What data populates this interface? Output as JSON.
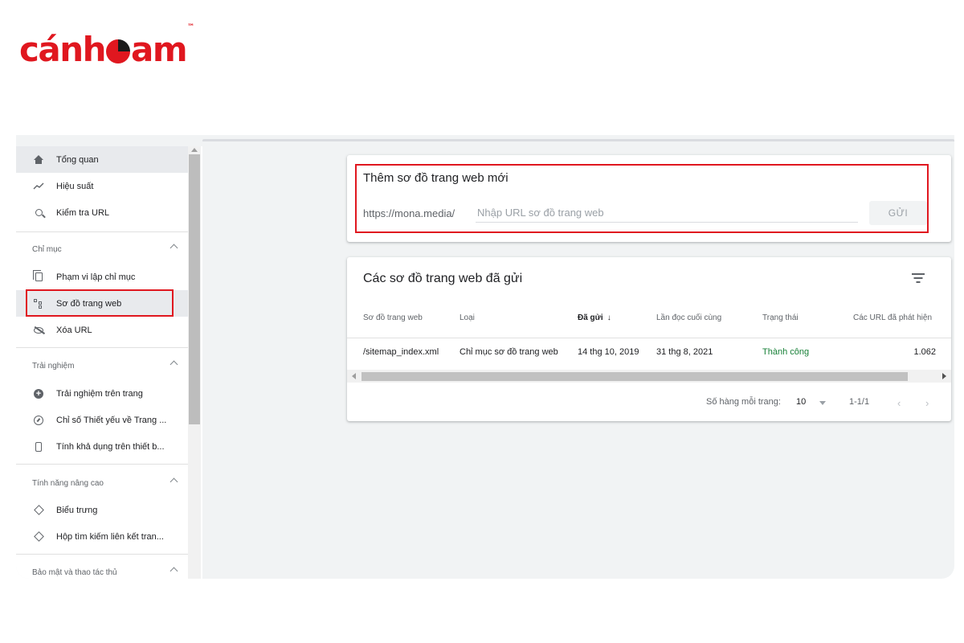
{
  "logo": {
    "part1": "cánh",
    "part2": "am",
    "tm": "™"
  },
  "sidebar": {
    "top_items": [
      {
        "label": "Tổng quan",
        "icon": "home-icon"
      },
      {
        "label": "Hiệu suất",
        "icon": "trending-up-icon"
      },
      {
        "label": "Kiểm tra URL",
        "icon": "search-icon"
      }
    ],
    "sections": [
      {
        "title": "Chỉ mục",
        "items": [
          {
            "label": "Phạm vi lập chỉ mục",
            "icon": "copy-icon"
          },
          {
            "label": "Sơ đồ trang web",
            "icon": "sitemap-icon",
            "active": true
          },
          {
            "label": "Xóa URL",
            "icon": "eye-off-icon"
          }
        ]
      },
      {
        "title": "Trải nghiệm",
        "items": [
          {
            "label": "Trải nghiệm trên trang",
            "icon": "add-circle-icon"
          },
          {
            "label": "Chỉ số Thiết yếu về Trang ...",
            "icon": "gauge-icon"
          },
          {
            "label": "Tính khả dụng trên thiết b...",
            "icon": "smartphone-icon"
          }
        ]
      },
      {
        "title": "Tính năng nâng cao",
        "items": [
          {
            "label": "Biểu trưng",
            "icon": "layers-icon"
          },
          {
            "label": "Hộp tìm kiếm liên kết tran...",
            "icon": "layers-icon"
          }
        ]
      },
      {
        "title": "Bảo mật và thao tác thủ"
      }
    ]
  },
  "add_sitemap": {
    "title": "Thêm sơ đồ trang web mới",
    "prefix": "https://mona.media/",
    "input_value": "",
    "input_placeholder": "Nhập URL sơ đồ trang web",
    "submit_label": "GỬI"
  },
  "submitted": {
    "title": "Các sơ đồ trang web đã gửi",
    "columns": [
      "Sơ đồ trang web",
      "Loại",
      "Đã gửi",
      "Lần đọc cuối cùng",
      "Trạng thái",
      "Các URL đã phát hiện"
    ],
    "sort_arrow": "↓",
    "rows": [
      {
        "sitemap": "/sitemap_index.xml",
        "type": "Chỉ mục sơ đồ trang web",
        "submitted": "14 thg 10, 2019",
        "last_read": "31 thg 8, 2021",
        "status": "Thành công",
        "urls": "1.062"
      }
    ],
    "pagination": {
      "rows_per_page_label": "Số hàng mỗi trang:",
      "rows_per_page": "10",
      "range": "1-1/1",
      "prev": "‹",
      "next": "›"
    }
  },
  "colors": {
    "brand_red": "#e0171f",
    "success": "#188038"
  }
}
